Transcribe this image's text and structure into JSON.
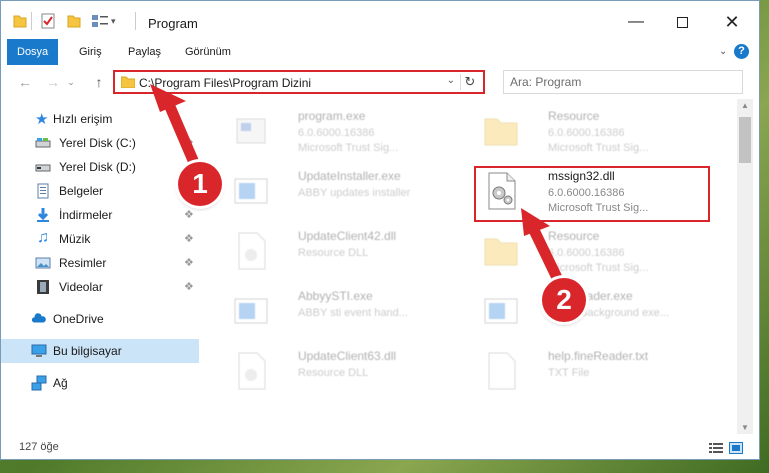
{
  "window": {
    "title": "Program"
  },
  "ribbon": {
    "tabs": [
      "Dosya",
      "Giriş",
      "Paylaş",
      "Görünüm"
    ],
    "help": "?"
  },
  "address": {
    "path": "C:\\Program Files\\Program Dizini",
    "search_placeholder": "Ara: Program"
  },
  "sidebar": {
    "items": [
      {
        "label": "Hızlı erişim"
      },
      {
        "label": "Yerel Disk (C:)"
      },
      {
        "label": "Yerel Disk (D:)"
      },
      {
        "label": "Belgeler"
      },
      {
        "label": "İndirmeler"
      },
      {
        "label": "Müzik"
      },
      {
        "label": "Resimler"
      },
      {
        "label": "Videolar"
      },
      {
        "label": "OneDrive"
      },
      {
        "label": "Bu bilgisayar"
      },
      {
        "label": "Ağ"
      }
    ]
  },
  "files": [
    {
      "name": "program.exe",
      "line1": "6.0.6000.16386",
      "line2": "Microsoft Trust Sig..."
    },
    {
      "name": "Resource",
      "line1": "6.0.6000.16386",
      "line2": "Microsoft Trust Sig..."
    },
    {
      "name": "UpdateInstaller.exe",
      "line1": "ABBY updates installer",
      "line2": ""
    },
    {
      "name": "mssign32.dll",
      "line1": "6.0.6000.16386",
      "line2": "Microsoft Trust Sig..."
    },
    {
      "name": "UpdateClient42.dll",
      "line1": "Resource DLL",
      "line2": ""
    },
    {
      "name": "Resource",
      "line1": "6.0.6000.16386",
      "line2": "Microsoft Trust Sig..."
    },
    {
      "name": "AbbyySTI.exe",
      "line1": "ABBY sti event hand...",
      "line2": ""
    },
    {
      "name": "FineReader.exe",
      "line1": "ABBY Background exe...",
      "line2": ""
    },
    {
      "name": "UpdateClient63.dll",
      "line1": "Resource DLL",
      "line2": ""
    },
    {
      "name": "help.fineReader.txt",
      "line1": "TXT File",
      "line2": ""
    }
  ],
  "status": {
    "count": "127 öğe"
  },
  "annotations": {
    "badge1": "1",
    "badge2": "2"
  },
  "colors": {
    "accent": "#1979ca",
    "annotation": "#d9262b",
    "selection": "#cce4f7"
  }
}
